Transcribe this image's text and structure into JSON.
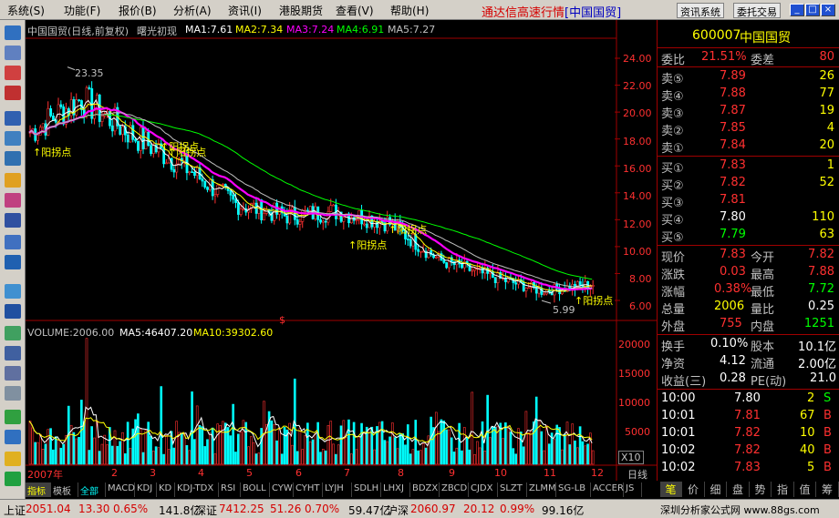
{
  "menu": [
    "系统(S)",
    "功能(F)",
    "报价(B)",
    "分析(A)",
    "资讯(I)",
    "港股期货",
    "查看(V)",
    "帮助(H)"
  ],
  "app_title": "通达信高速行情",
  "app_title_suffix": "[中国国贸]",
  "buttons": {
    "news": "资讯系统",
    "trade": "委托交易"
  },
  "chart_header": {
    "name": "中国国贸(日线,前复权)",
    "indicator": "曙光初现",
    "ma1": "MA1:7.61",
    "ma2": "MA2:7.34",
    "ma3": "MA3:7.24",
    "ma4": "MA4:6.91",
    "ma5": "MA5:7.27"
  },
  "volume_header": {
    "volume": "VOLUME:2006.00",
    "ma5": "MA5:46407.20",
    "ma10": "MA10:39302.60"
  },
  "annotations": {
    "high": "23.35",
    "low": "5.99",
    "signal": "↑阳拐点",
    "multiplier": "X10",
    "period": "日线",
    "s_marker": "$"
  },
  "price_axis": [
    "24.00",
    "22.00",
    "20.00",
    "18.00",
    "16.00",
    "14.00",
    "12.00",
    "10.00",
    "8.00",
    "6.00"
  ],
  "volume_axis": [
    "20000",
    "15000",
    "10000",
    "5000"
  ],
  "x_axis": [
    "2007年",
    "2",
    "3",
    "4",
    "5",
    "6",
    "7",
    "8",
    "9",
    "10",
    "11",
    "12"
  ],
  "stock": {
    "code": "600007",
    "name": "中国国贸"
  },
  "order_ratio": {
    "label1": "委比",
    "value1": "21.51%",
    "label2": "委差",
    "value2": "80"
  },
  "asks": [
    {
      "label": "卖⑤",
      "price": "7.89",
      "vol": "26"
    },
    {
      "label": "卖④",
      "price": "7.88",
      "vol": "77"
    },
    {
      "label": "卖③",
      "price": "7.87",
      "vol": "19"
    },
    {
      "label": "卖②",
      "price": "7.85",
      "vol": "4"
    },
    {
      "label": "卖①",
      "price": "7.84",
      "vol": "20"
    }
  ],
  "bids": [
    {
      "label": "买①",
      "price": "7.83",
      "vol": "1"
    },
    {
      "label": "买②",
      "price": "7.82",
      "vol": "52"
    },
    {
      "label": "买③",
      "price": "7.81",
      "vol": ""
    },
    {
      "label": "买④",
      "price": "7.80",
      "vol": "110"
    },
    {
      "label": "买⑤",
      "price": "7.79",
      "vol": "63"
    }
  ],
  "quote": [
    {
      "l1": "现价",
      "v1": "7.83",
      "l2": "今开",
      "v2": "7.82"
    },
    {
      "l1": "涨跌",
      "v1": "0.03",
      "l2": "最高",
      "v2": "7.88"
    },
    {
      "l1": "涨幅",
      "v1": "0.38%",
      "l2": "最低",
      "v2": "7.72"
    },
    {
      "l1": "总量",
      "v1": "2006",
      "l2": "量比",
      "v2": "0.25"
    },
    {
      "l1": "外盘",
      "v1": "755",
      "l2": "内盘",
      "v2": "1251"
    }
  ],
  "fundamentals": [
    {
      "l1": "换手",
      "v1": "0.10%",
      "l2": "股本",
      "v2": "10.1亿"
    },
    {
      "l1": "净资",
      "v1": "4.12",
      "l2": "流通",
      "v2": "2.00亿"
    },
    {
      "l1": "收益(三)",
      "v1": "0.28",
      "l2": "PE(动)",
      "v2": "21.0"
    }
  ],
  "ticks": [
    {
      "time": "10:00",
      "price": "7.80",
      "vol": "2",
      "side": "S"
    },
    {
      "time": "10:01",
      "price": "7.81",
      "vol": "67",
      "side": "B"
    },
    {
      "time": "10:01",
      "price": "7.82",
      "vol": "10",
      "side": "B"
    },
    {
      "time": "10:02",
      "price": "7.82",
      "vol": "40",
      "side": "B"
    },
    {
      "time": "10:02",
      "price": "7.83",
      "vol": "5",
      "side": "B"
    }
  ],
  "bottom_tabs": [
    "指标",
    "模板",
    "全部",
    "MACD",
    "KDJ",
    "KD",
    "KDJ-TDX",
    "RSI",
    "BOLL",
    "CYW",
    "CYHT",
    "LYJH",
    "SDLH",
    "LHXJ",
    "BDZX",
    "ZBCD",
    "CJDX",
    "SLZT",
    "ZLMM",
    "SG-LB",
    "ACCER",
    "JS"
  ],
  "right_tabs": [
    "笔",
    "价",
    "细",
    "盘",
    "势",
    "指",
    "值",
    "筹"
  ],
  "status": {
    "sh_label": "上证",
    "sh_val": "2051.04",
    "sh_chg": "13.30",
    "sh_pct": "0.65%",
    "sh_amt": "141.8亿",
    "sz_label": "深证",
    "sz_val": "7412.25",
    "sz_chg": "51.26",
    "sz_pct": "0.70%",
    "sz_amt": "59.47亿",
    "hs_label": "沪深",
    "hs_val": "2060.97",
    "hs_chg": "20.12",
    "hs_pct": "0.99%",
    "hs_amt": "99.16亿",
    "right": "深圳分析家公式网 www.88gs.com"
  },
  "colors": {
    "up": "#ff3030",
    "down": "#00ffff",
    "ma1": "#ffffff",
    "ma2": "#ffff00",
    "ma3": "#ff00ff",
    "ma4": "#00ff00",
    "ma5": "#c0c0c0",
    "grid": "#a00000"
  },
  "chart_data": {
    "type": "line",
    "title": "中国国贸(日线,前复权)",
    "x": [
      "2007年",
      "2",
      "3",
      "4",
      "5",
      "6",
      "7",
      "8",
      "9",
      "10",
      "11",
      "12"
    ],
    "series": [
      {
        "name": "MA3",
        "values": [
          18.5,
          21.0,
          18.3,
          16.0,
          13.2,
          12.3,
          12.6,
          11.8,
          9.0,
          7.8,
          6.7,
          7.2
        ]
      }
    ],
    "ylim": [
      6.0,
      24.0
    ],
    "price_high": 23.35,
    "price_low": 5.99
  }
}
